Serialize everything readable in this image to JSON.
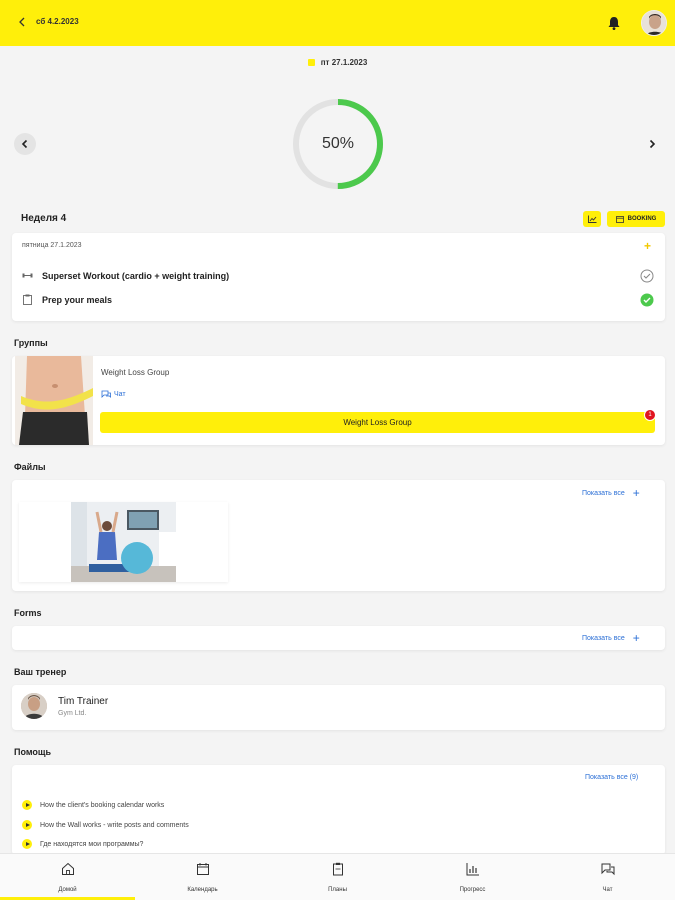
{
  "header": {
    "date": "сб 4.2.2023",
    "back_icon": "chevron-left-icon",
    "bell_icon": "bell-icon",
    "avatar_icon": "user-avatar"
  },
  "colors": {
    "accent": "#ffef0a",
    "link": "#2b6fd6",
    "success": "#4cc94c",
    "badge": "#e0141e"
  },
  "current_date": "пт 27.1.2023",
  "progress": {
    "label": "50%",
    "value": 0.5
  },
  "week": {
    "title": "Неделя 4",
    "booking_label": "BOOKING"
  },
  "day": {
    "header": "пятница  27.1.2023",
    "add_symbol": "+",
    "tasks": [
      {
        "label": "Superset Workout (cardio + weight training)",
        "icon": "dumbbell-icon",
        "done": false
      },
      {
        "label": "Prep your meals",
        "icon": "clipboard-icon",
        "done": true
      }
    ]
  },
  "groups": {
    "title": "Группы",
    "name": "Weight Loss Group",
    "chat_label": "Чат",
    "button_label": "Weight Loss Group",
    "badge": "1"
  },
  "files": {
    "title": "Файлы",
    "show_all": "Показать все"
  },
  "forms": {
    "title": "Forms",
    "show_all": "Показать все"
  },
  "trainer": {
    "title": "Ваш тренер",
    "name": "Tim Trainer",
    "org": "Gym Ltd."
  },
  "help": {
    "title": "Помощь",
    "show_all": "Показать все (9)",
    "items": [
      "How the client's booking calendar works",
      "How the Wall works - write posts and comments",
      "Где находятся мои программы?"
    ]
  },
  "bottom_nav": [
    {
      "label": "Домой",
      "icon": "home-icon"
    },
    {
      "label": "Календарь",
      "icon": "calendar-icon"
    },
    {
      "label": "Планы",
      "icon": "plan-icon"
    },
    {
      "label": "Прогресс",
      "icon": "progress-chart-icon"
    },
    {
      "label": "Чат",
      "icon": "chat-icon"
    }
  ]
}
